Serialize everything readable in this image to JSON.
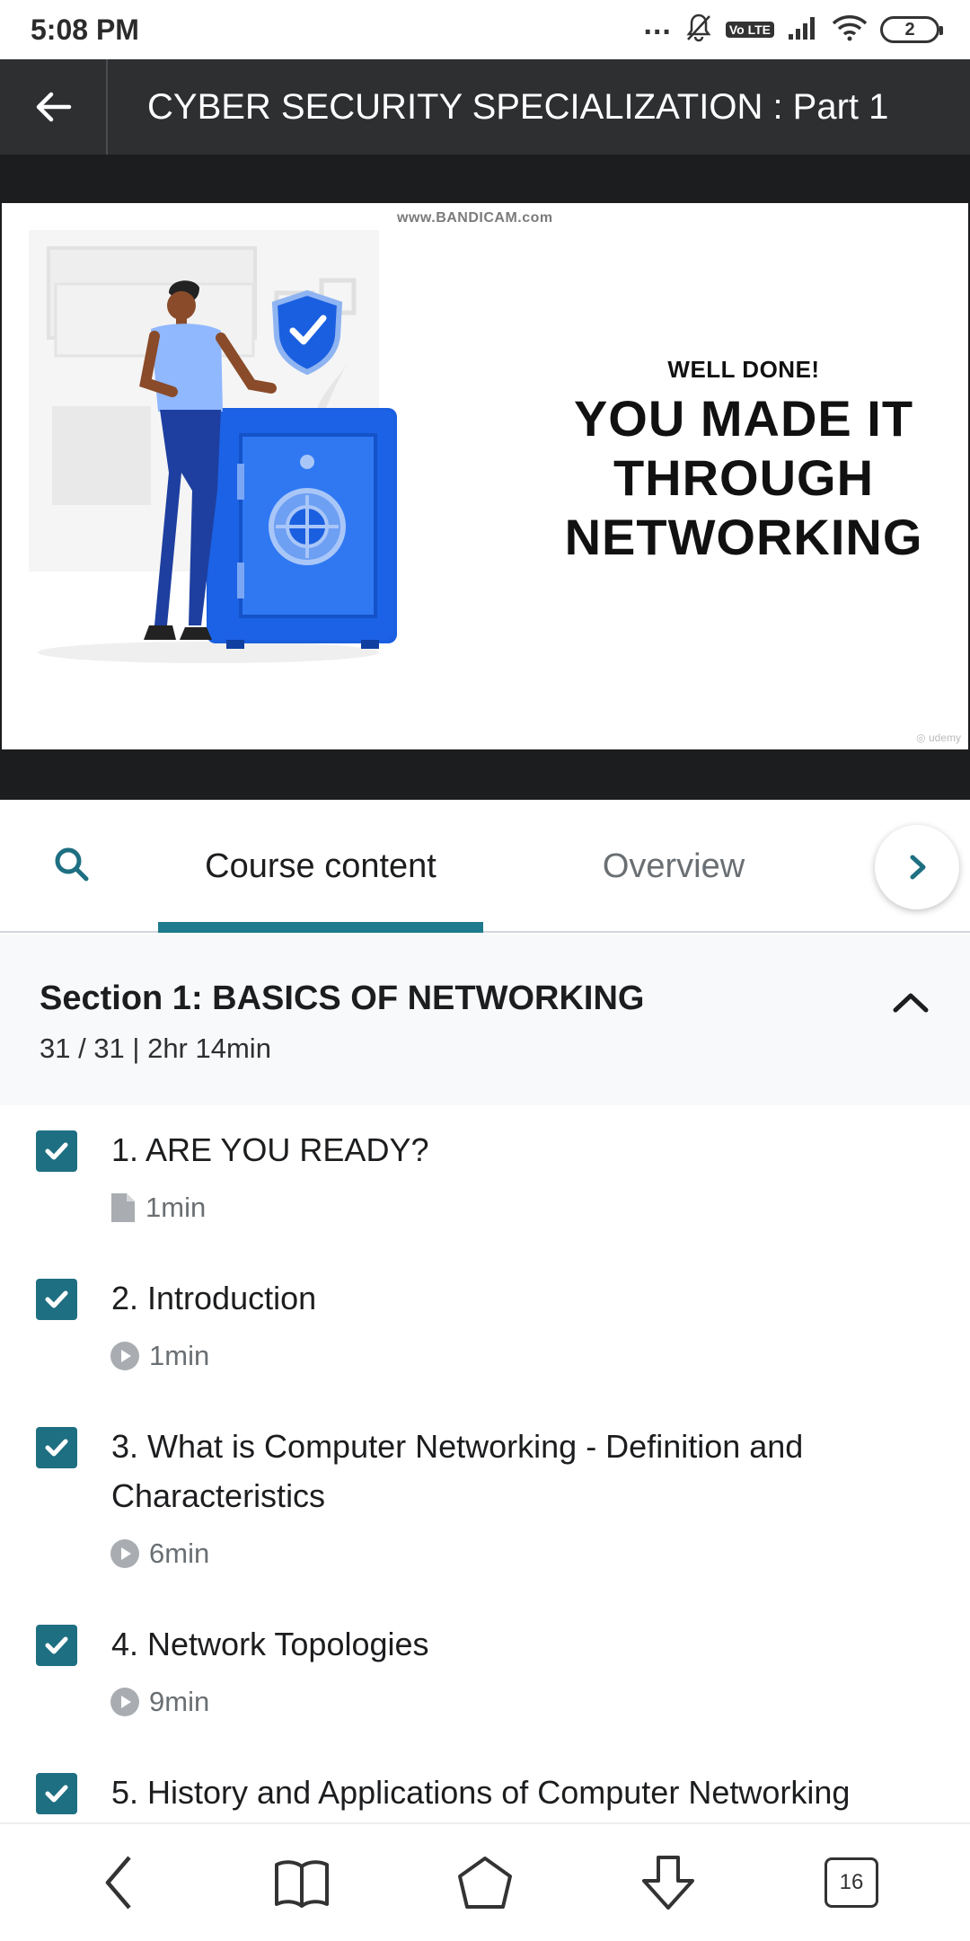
{
  "status_bar": {
    "time": "5:08 PM",
    "dots": "...",
    "volte": "Vo LTE",
    "battery": "2"
  },
  "header": {
    "title": "CYBER SECURITY SPECIALIZATION : Part 1"
  },
  "video": {
    "watermark": "www.BANDICAM.com",
    "kicker": "WELL DONE!",
    "headline": [
      "YOU MADE IT",
      "THROUGH",
      "NETWORKING"
    ]
  },
  "tabs": {
    "items": [
      {
        "label": "Course content",
        "active": true
      },
      {
        "label": "Overview",
        "active": false
      }
    ]
  },
  "section": {
    "title": "Section 1: BASICS OF NETWORKING",
    "meta": "31 / 31 | 2hr 14min"
  },
  "lessons": [
    {
      "title": "1. ARE YOU READY?",
      "icon": "document-icon",
      "duration": "1min",
      "completed": true
    },
    {
      "title": "2. Introduction",
      "icon": "play-icon",
      "duration": "1min",
      "completed": true
    },
    {
      "title": "3. What is Computer Networking - Definition and Characteristics",
      "icon": "play-icon",
      "duration": "6min",
      "completed": true
    },
    {
      "title": "4. Network Topologies",
      "icon": "play-icon",
      "duration": "9min",
      "completed": true
    },
    {
      "title": "5. History and Applications of Computer Networking",
      "icon": "play-icon",
      "duration": "",
      "completed": true
    }
  ],
  "bottom_nav": {
    "tabs_count": "16"
  },
  "colors": {
    "header_bg": "#2d2f31",
    "accent": "#1e7a8c",
    "checkbox": "#1e6f82",
    "video_bg": "#1c1d1f",
    "safe_blue": "#1a5fe0"
  }
}
